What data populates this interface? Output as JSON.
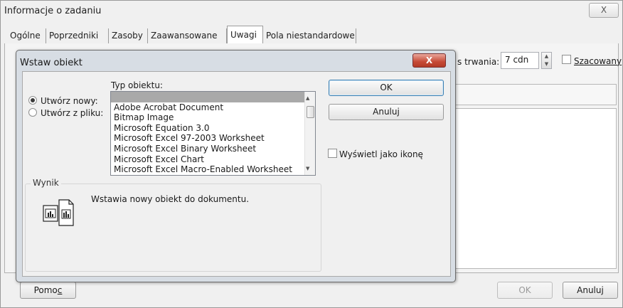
{
  "outer_dialog": {
    "title": "Informacje o zadaniu",
    "close_glyph": "X",
    "tabs": [
      {
        "label": "Ogólne",
        "active": false
      },
      {
        "label": "Poprzedniki",
        "active": false
      },
      {
        "label": "Zasoby",
        "active": false
      },
      {
        "label": "Zaawansowane",
        "active": false
      },
      {
        "label": "Uwagi",
        "active": true
      },
      {
        "label": "Pola niestandardowe",
        "active": false
      }
    ],
    "duration_label": "s trwania:",
    "duration_value": "7 cdn",
    "estimated_label": "Szacowany",
    "help_label": "Pomoc",
    "ok_label": "OK",
    "cancel_label": "Anuluj"
  },
  "insert_object": {
    "title": "Wstaw obiekt",
    "close_glyph": "X",
    "radio_new_label": "Utwórz nowy:",
    "radio_file_label": "Utwórz z pliku:",
    "selected_radio": "new",
    "type_label": "Typ obiektu:",
    "object_types": [
      "",
      "Adobe Acrobat Document",
      "Bitmap Image",
      "Microsoft Equation 3.0",
      "Microsoft Excel 97-2003 Worksheet",
      "Microsoft Excel Binary Worksheet",
      "Microsoft Excel Chart",
      "Microsoft Excel Macro-Enabled Worksheet"
    ],
    "selected_index": 0,
    "ok_label": "OK",
    "cancel_label": "Anuluj",
    "display_as_icon_label": "Wyświetl jako ikonę",
    "display_as_icon_checked": false,
    "result_legend": "Wynik",
    "result_text": "Wstawia nowy obiekt  do dokumentu."
  },
  "icons": {
    "outer_close": "close-icon",
    "insert_close": "close-icon",
    "scroll_up": "arrow-up-icon",
    "scroll_down": "arrow-down-icon",
    "spin": "spinner-icon",
    "result": "insert-object-icon"
  },
  "colors": {
    "insert_close_bg": "#c64a36",
    "list_selection": "#a9a9a9",
    "dialog_frame": "#d7dde4"
  }
}
